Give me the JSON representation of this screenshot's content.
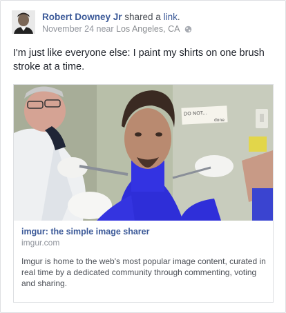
{
  "post": {
    "author": "Robert Downey Jr",
    "action_prefix": " shared a ",
    "action_link": "link",
    "action_suffix": ".",
    "date": "November 24",
    "near": " near ",
    "location": "Los Angeles, CA",
    "privacy_icon": "globe-icon",
    "message": "I'm just like everyone else: I paint my shirts on one brush stroke at a time."
  },
  "shared_link": {
    "title": "imgur: the simple image sharer",
    "domain": "imgur.com",
    "description": "Imgur is home to the web's most popular image content, curated in real time by a dedicated community through commenting, voting and sharing.",
    "sign_text": "DO NOT...",
    "sign_text_2": "done"
  },
  "colors": {
    "link_blue": "#3b5998",
    "meta_gray": "#90949c",
    "paint_blue": "#2f2fd9"
  }
}
